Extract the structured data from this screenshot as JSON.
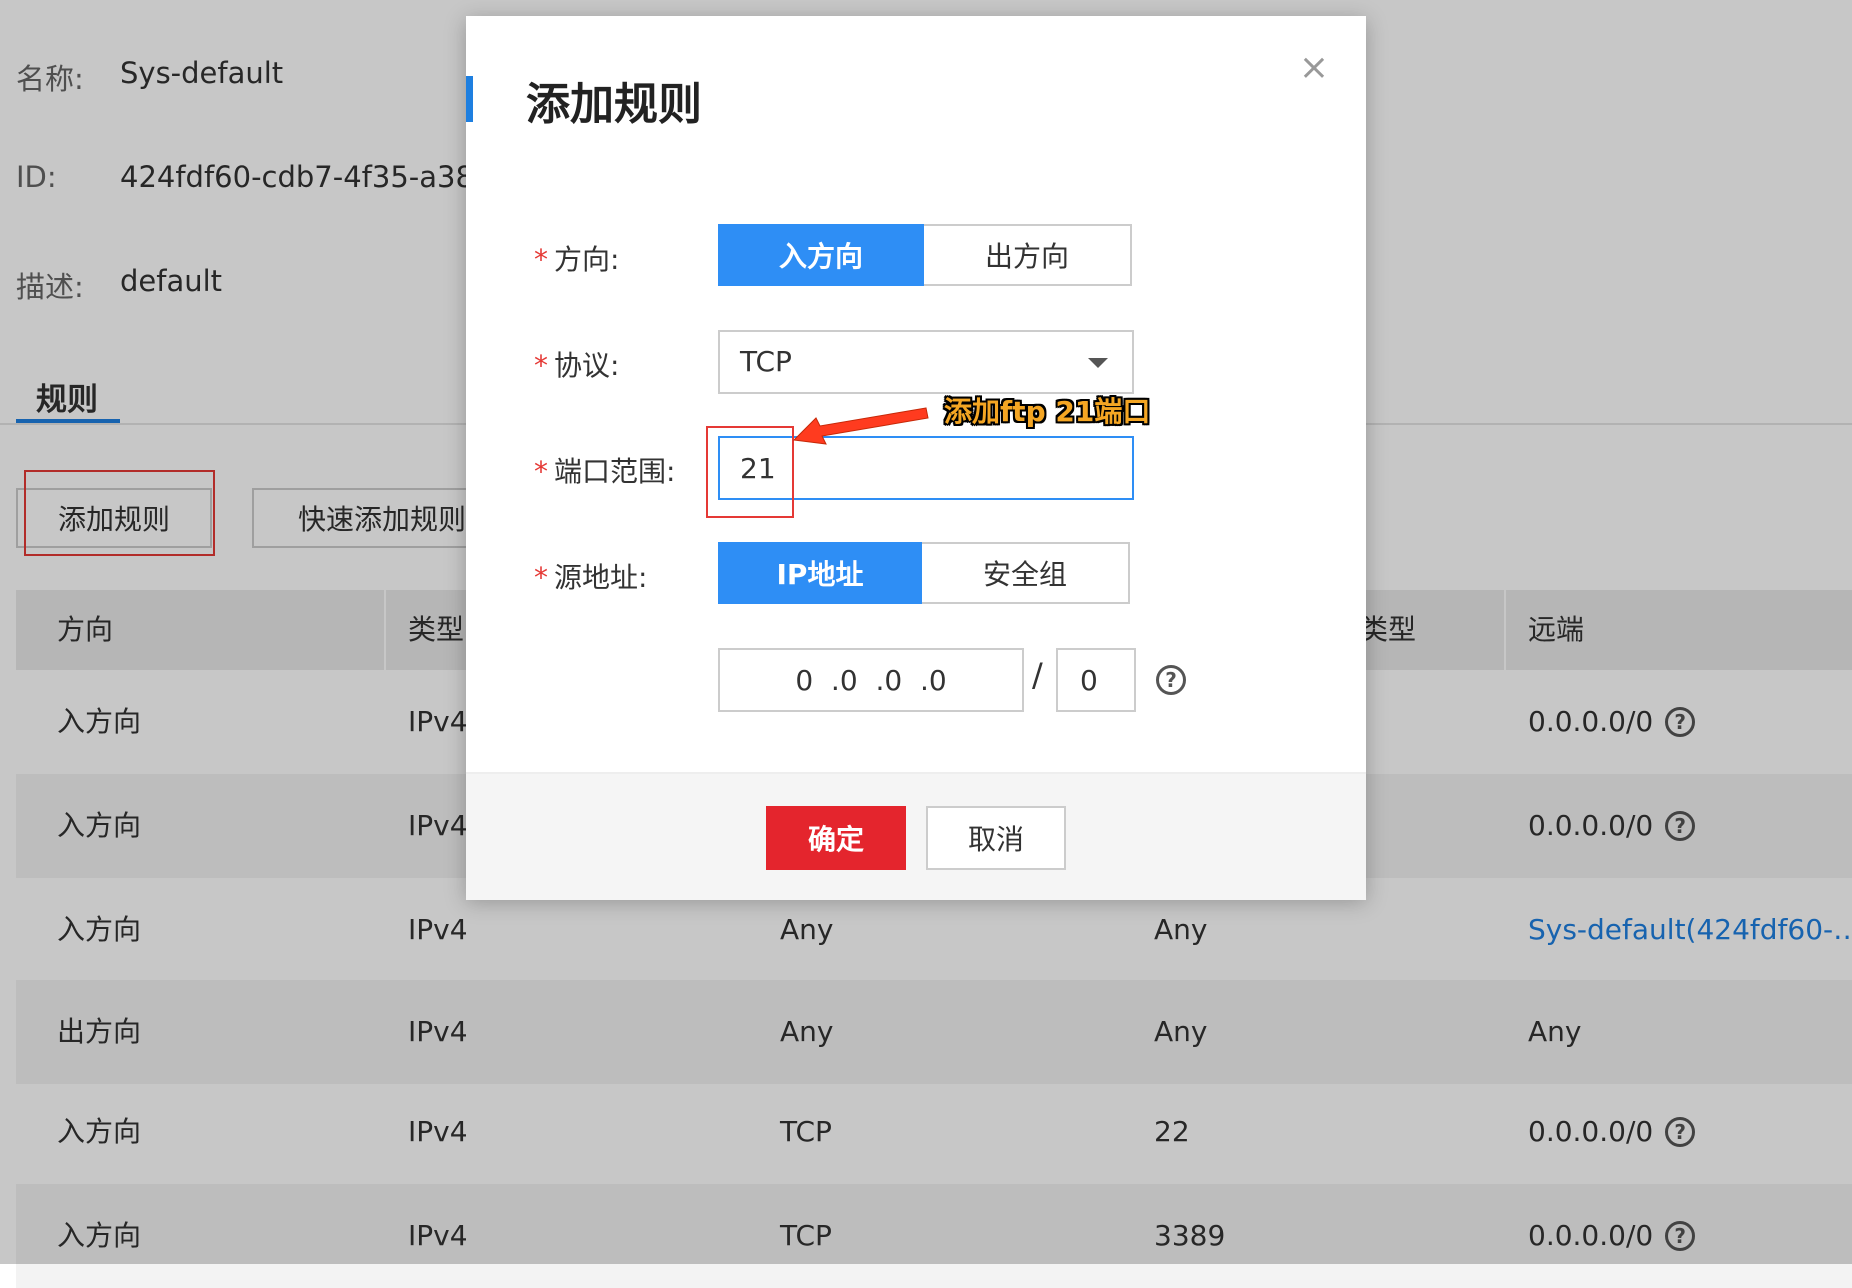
{
  "info": {
    "name_label": "名称:",
    "name_value": "Sys-default",
    "id_label": "ID:",
    "id_value": "424fdf60-cdb7-4f35-a38",
    "desc_label": "描述:",
    "desc_value": "default"
  },
  "tab": {
    "label": "规则"
  },
  "toolbar": {
    "add_rule": "添加规则",
    "quick_add_rule": "快速添加规则"
  },
  "table": {
    "headers": [
      "方向",
      "类型",
      "",
      "类型",
      "远端"
    ],
    "rows": [
      {
        "direction": "入方向",
        "type": "IPv4",
        "protocol": "",
        "port": "",
        "remote": "0.0.0.0/0",
        "remote_help": true,
        "remote_link": false
      },
      {
        "direction": "入方向",
        "type": "IPv4",
        "protocol": "",
        "port": "",
        "remote": "0.0.0.0/0",
        "remote_help": true,
        "remote_link": false
      },
      {
        "direction": "入方向",
        "type": "IPv4",
        "protocol": "Any",
        "port": "Any",
        "remote": "Sys-default(424fdf60-…",
        "remote_help": false,
        "remote_link": true
      },
      {
        "direction": "出方向",
        "type": "IPv4",
        "protocol": "Any",
        "port": "Any",
        "remote": "Any",
        "remote_help": false,
        "remote_link": false
      },
      {
        "direction": "入方向",
        "type": "IPv4",
        "protocol": "TCP",
        "port": "22",
        "remote": "0.0.0.0/0",
        "remote_help": true,
        "remote_link": false
      },
      {
        "direction": "入方向",
        "type": "IPv4",
        "protocol": "TCP",
        "port": "3389",
        "remote": "0.0.0.0/0",
        "remote_help": true,
        "remote_link": false
      }
    ]
  },
  "modal": {
    "title": "添加规则",
    "close_symbol": "×",
    "required_mark": "*",
    "direction_label": "方向:",
    "direction_options": [
      "入方向",
      "出方向"
    ],
    "direction_selected": 0,
    "protocol_label": "协议:",
    "protocol_value": "TCP",
    "port_label": "端口范围:",
    "port_value": "21",
    "source_label": "源地址:",
    "source_options": [
      "IP地址",
      "安全组"
    ],
    "source_selected": 0,
    "ip_value": "0  .0  .0  .0",
    "ip_separator": "/",
    "mask_value": "0",
    "help_symbol": "?",
    "confirm": "确定",
    "cancel": "取消"
  },
  "annotation": {
    "text": "添加ftp 21端口",
    "color": "#f5a623"
  },
  "colors": {
    "primary": "#2e8ef5",
    "danger": "#e4252d",
    "highlight_box": "#e53935",
    "link": "#1e7fe0"
  }
}
